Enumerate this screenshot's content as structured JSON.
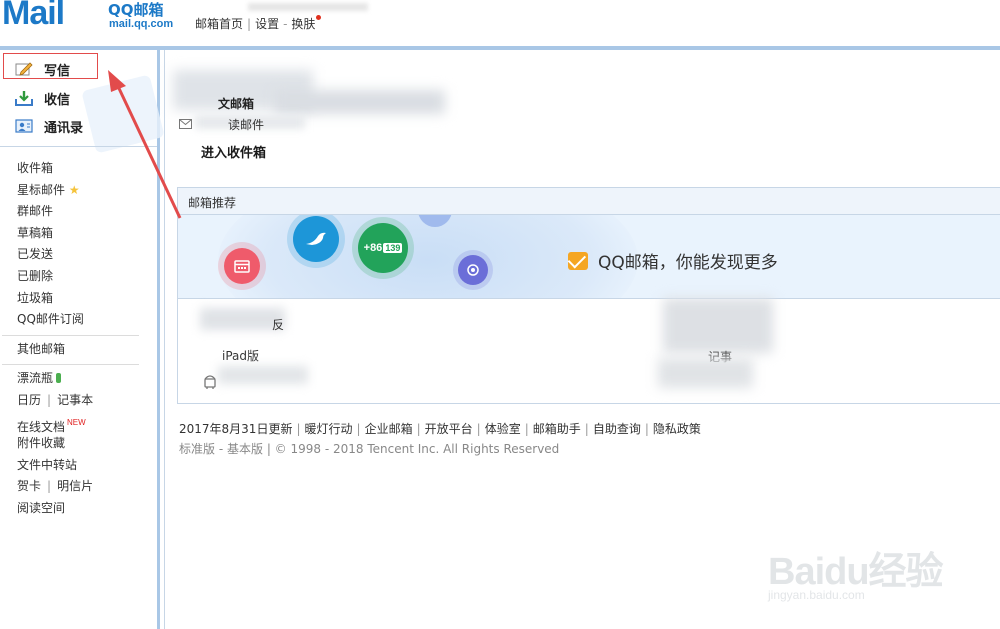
{
  "header": {
    "logo_text": "Mail",
    "brand": "QQ邮箱",
    "domain": "mail.qq.com",
    "links": [
      "邮箱首页",
      "设置",
      "换肤"
    ]
  },
  "sidebar": {
    "actions": [
      {
        "label": "写信",
        "icon": "pencil-icon"
      },
      {
        "label": "收信",
        "icon": "inbox-download-icon"
      },
      {
        "label": "通讯录",
        "icon": "contacts-icon"
      }
    ],
    "folders": [
      "收件箱",
      "星标邮件",
      "群邮件",
      "草稿箱",
      "已发送",
      "已删除",
      "垃圾箱",
      "QQ邮件订阅"
    ],
    "other_mailbox": "其他邮箱",
    "tools": {
      "drift_bottle": "漂流瓶",
      "calendar": "日历",
      "notepad": "记事本",
      "online_docs": "在线文档",
      "new_badge": "NEW",
      "attachments": "附件收藏",
      "file_transfer": "文件中转站",
      "greeting_card": "贺卡",
      "postcard": "明信片",
      "reading_space": "阅读空间"
    }
  },
  "main": {
    "partial_heading": "文邮箱",
    "unread_text": "读邮件",
    "inbox_link": "进入收件箱",
    "promo": {
      "title": "邮箱推荐",
      "banner_text": "QQ邮箱，你能发现更多",
      "badge_text": "+86",
      "badge_num": "139",
      "labels": [
        "反",
        "iPad版",
        "记事"
      ]
    },
    "footer_links": [
      "2017年8月31日更新",
      "暖灯行动",
      "企业邮箱",
      "开放平台",
      "体验室",
      "邮箱助手",
      "自助查询",
      "隐私政策"
    ],
    "footer_version_standard": "标准版",
    "footer_version_basic": "基本版",
    "footer_copyright": "© 1998 - 2018 Tencent Inc. All Rights Reserved"
  },
  "watermark": {
    "main": "Baidu经验",
    "sub": "jingyan.baidu.com"
  },
  "colors": {
    "brand_blue": "#1c79c7",
    "frame_blue": "#a9c7e6",
    "annotation_red": "#e24b4b"
  }
}
